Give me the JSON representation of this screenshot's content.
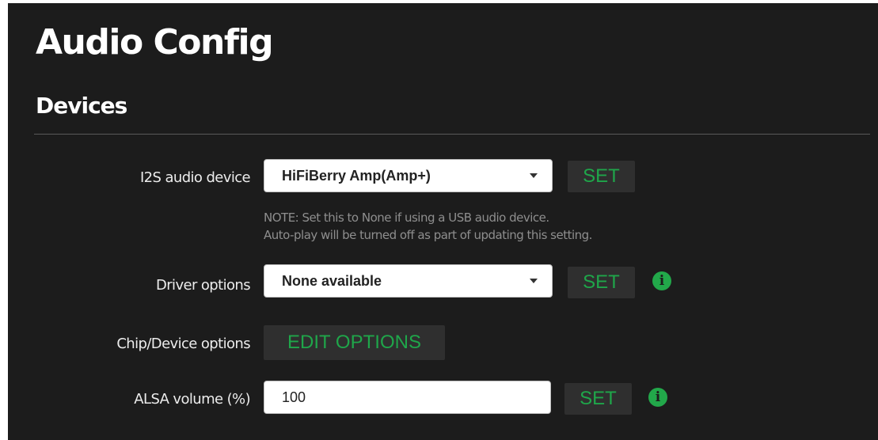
{
  "page": {
    "title": "Audio Config"
  },
  "devices": {
    "heading": "Devices",
    "i2s": {
      "label": "I2S audio device",
      "selected": "HiFiBerry Amp(Amp+)",
      "set_label": "SET",
      "note_line1": "NOTE: Set this to None if using a USB audio device.",
      "note_line2": "Auto-play will be turned off as part of updating this setting."
    },
    "driver": {
      "label": "Driver options",
      "selected": "None available",
      "set_label": "SET",
      "info_icon": "i"
    },
    "chip": {
      "label": "Chip/Device options",
      "edit_label": "EDIT OPTIONS"
    },
    "alsa": {
      "label": "ALSA volume (%)",
      "value": "100",
      "set_label": "SET",
      "info_icon": "i"
    }
  },
  "colors": {
    "background": "#1c1c1c",
    "accent": "#1fa64a",
    "button_bg": "#2f2f2f"
  }
}
